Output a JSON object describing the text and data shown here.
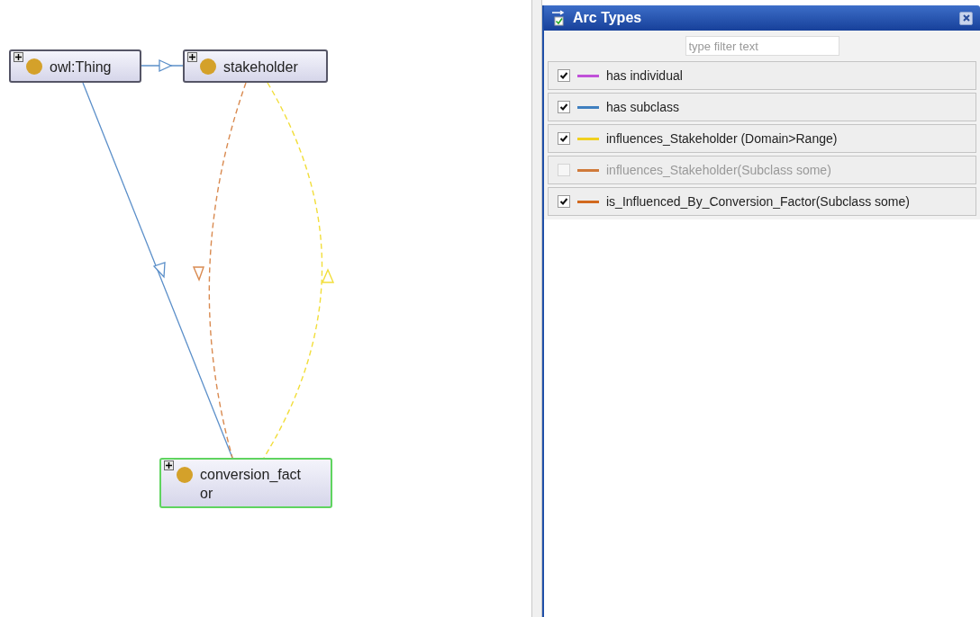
{
  "graph": {
    "nodes": [
      {
        "label": "owl:Thing",
        "selected": false
      },
      {
        "label": "stakeholder",
        "selected": false
      },
      {
        "label": "conversion_factor",
        "selected": true
      }
    ]
  },
  "panel": {
    "title": "Arc Types",
    "filter": {
      "placeholder": "type filter text"
    },
    "arc_types": [
      {
        "label": "has individual",
        "checked": true,
        "color": "#c050d8"
      },
      {
        "label": "has subclass",
        "checked": true,
        "color": "#3f7fbf"
      },
      {
        "label": "influences_Stakeholder (Domain>Range)",
        "checked": true,
        "color": "#f0d020"
      },
      {
        "label": "influences_Stakeholder(Subclass some)",
        "checked": false,
        "color": "#d07a3a"
      },
      {
        "label": "is_Influenced_By_Conversion_Factor(Subclass some)",
        "checked": true,
        "color": "#d2691e"
      }
    ]
  }
}
